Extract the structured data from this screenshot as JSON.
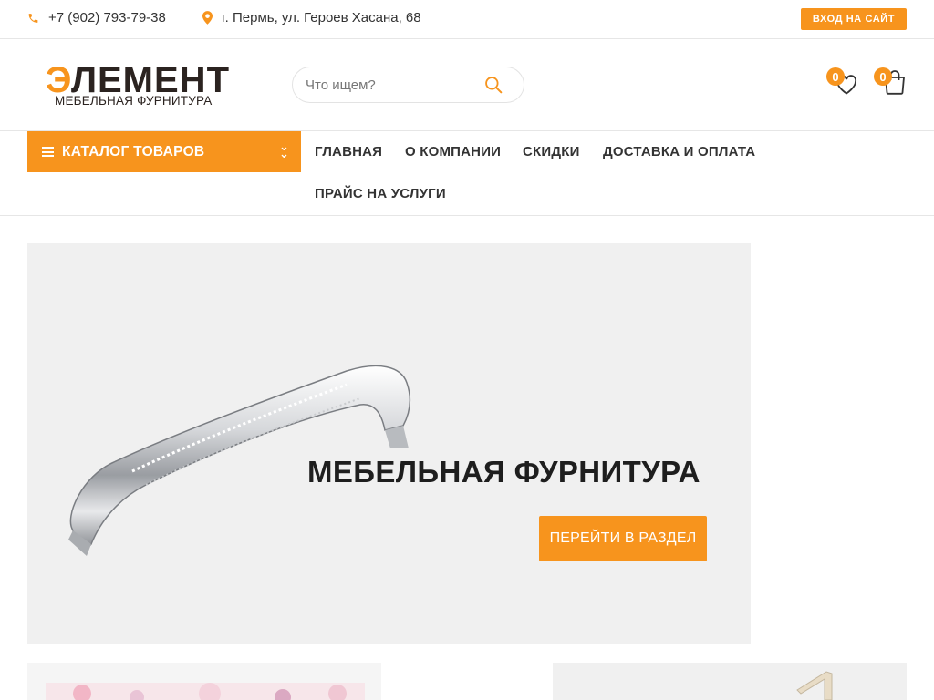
{
  "topbar": {
    "phone": "+7 (902) 793-79-38",
    "address": "г. Пермь, ул. Героев Хасана, 68",
    "login_label": "ВХОД НА САЙТ"
  },
  "header": {
    "logo_first_letter": "Э",
    "logo_rest": "ЛЕМЕНТ",
    "logo_subtitle": "МЕБЕЛЬНАЯ ФУРНИТУРА",
    "search_placeholder": "Что ищем?",
    "wishlist_count": "0",
    "cart_count": "0"
  },
  "nav": {
    "catalog_label": "КАТАЛОГ ТОВАРОВ",
    "items": [
      {
        "label": "ГЛАВНАЯ"
      },
      {
        "label": "О КОМПАНИИ"
      },
      {
        "label": "СКИДКИ"
      },
      {
        "label": "ДОСТАВКА И ОПЛАТА"
      },
      {
        "label": "ПРАЙС НА УСЛУГИ"
      }
    ]
  },
  "banner": {
    "title": "МЕБЕЛЬНАЯ ФУРНИТУРА",
    "button_label": "ПЕРЕЙТИ В РАЗДЕЛ"
  },
  "icons": {
    "phone": "phone-icon",
    "address": "map-pin-icon",
    "search": "search-icon",
    "wishlist": "heart-icon",
    "cart": "shopping-bag-icon",
    "catalog": "menu-icon",
    "catalog_toggle": "chevron-double-down-icon"
  },
  "colors": {
    "accent": "#f7941d",
    "logo_dark": "#2b2320",
    "banner_bg": "#f0f0f0"
  }
}
